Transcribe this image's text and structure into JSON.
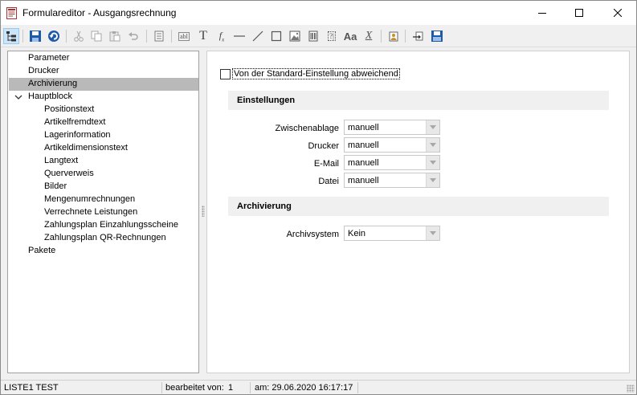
{
  "window": {
    "title": "Formulareditor - Ausgangsrechnung"
  },
  "toolbar": {
    "buttons": [
      {
        "name": "tree-view-icon",
        "active": true
      },
      {
        "name": "save-icon"
      },
      {
        "name": "undo-arrow-icon"
      },
      {
        "name": "cut-icon"
      },
      {
        "name": "copy-icon"
      },
      {
        "name": "paste-icon"
      },
      {
        "name": "undo-icon"
      },
      {
        "name": "properties-icon"
      },
      {
        "name": "label-field-icon",
        "text": "abl"
      },
      {
        "name": "text-icon",
        "text": "T"
      },
      {
        "name": "formula-icon",
        "text": "fx"
      },
      {
        "name": "horizontal-line-icon"
      },
      {
        "name": "diagonal-line-icon"
      },
      {
        "name": "rectangle-icon"
      },
      {
        "name": "image-icon"
      },
      {
        "name": "barcode-icon"
      },
      {
        "name": "variable-field-icon"
      },
      {
        "name": "font-icon",
        "text": "Aa"
      },
      {
        "name": "clear-format-icon",
        "text": "X"
      },
      {
        "name": "clipboard-user-icon"
      },
      {
        "name": "import-icon"
      },
      {
        "name": "save-disk-icon"
      }
    ]
  },
  "tree": {
    "items": [
      {
        "label": "Parameter",
        "level": 0
      },
      {
        "label": "Drucker",
        "level": 0
      },
      {
        "label": "Archivierung",
        "level": 0,
        "selected": true
      },
      {
        "label": "Hauptblock",
        "level": 0,
        "expanded": true
      },
      {
        "label": "Positionstext",
        "level": 1
      },
      {
        "label": "Artikelfremdtext",
        "level": 1
      },
      {
        "label": "Lagerinformation",
        "level": 1
      },
      {
        "label": "Artikeldimensionstext",
        "level": 1
      },
      {
        "label": "Langtext",
        "level": 1
      },
      {
        "label": "Querverweis",
        "level": 1
      },
      {
        "label": "Bilder",
        "level": 1
      },
      {
        "label": "Mengenumrechnungen",
        "level": 1
      },
      {
        "label": "Verrechnete Leistungen",
        "level": 1
      },
      {
        "label": "Zahlungsplan Einzahlungsscheine",
        "level": 1
      },
      {
        "label": "Zahlungsplan QR-Rechnungen",
        "level": 1
      },
      {
        "label": "Pakete",
        "level": 0
      }
    ]
  },
  "settings": {
    "override_checkbox": {
      "label": "Von der Standard-Einstellung abweichend",
      "checked": false
    },
    "einstellungen": {
      "header": "Einstellungen",
      "fields": [
        {
          "label": "Zwischenablage",
          "value": "manuell"
        },
        {
          "label": "Drucker",
          "value": "manuell"
        },
        {
          "label": "E-Mail",
          "value": "manuell"
        },
        {
          "label": "Datei",
          "value": "manuell"
        }
      ]
    },
    "archivierung": {
      "header": "Archivierung",
      "fields": [
        {
          "label": "Archivsystem",
          "value": "Kein"
        }
      ]
    }
  },
  "statusbar": {
    "user": "LISTE1 TEST",
    "edited_label": "bearbeitet von:",
    "edited_value": "1",
    "date_label": "am: 29.06.2020 16:17:17"
  },
  "colors": {
    "selection": "#b9b9b9",
    "toolbar_active": "#cce4f7",
    "save_blue": "#1e5aa8"
  }
}
